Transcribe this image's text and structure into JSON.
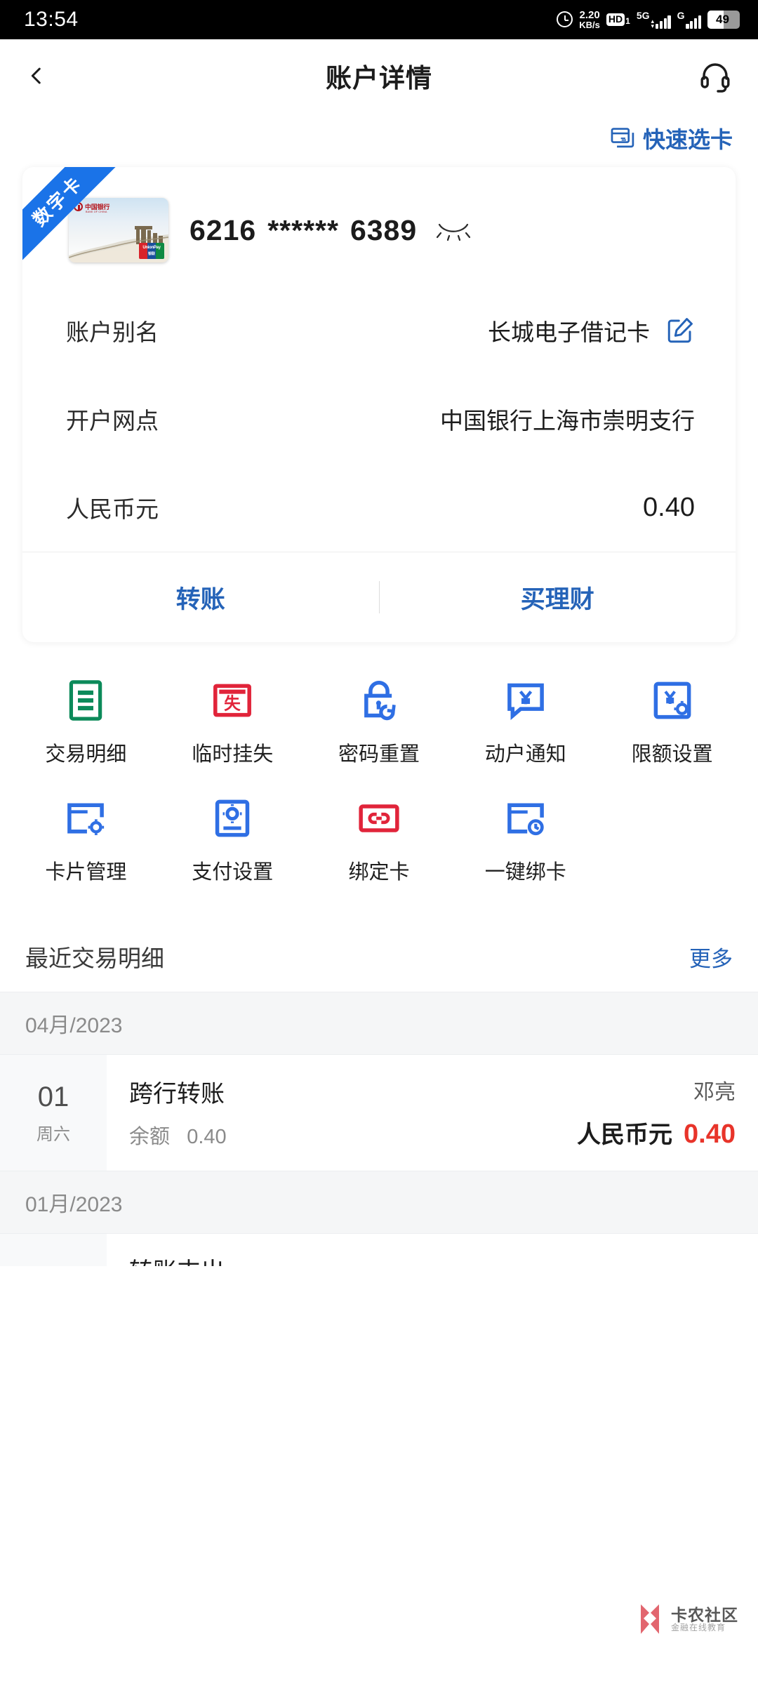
{
  "status_bar": {
    "time": "13:54",
    "network_speed": "2.20",
    "network_speed_unit": "KB/s",
    "hd_label": "HD",
    "hd_sim": "1",
    "sim1_network": "5G",
    "sim2_network": "G",
    "battery": "49"
  },
  "header": {
    "title": "账户详情",
    "back_icon": "chevron-left-icon",
    "service_icon": "headset-icon"
  },
  "quick_select": {
    "label": "快速选卡",
    "icon": "card-stack-icon",
    "color": "#2563b8"
  },
  "card": {
    "ribbon": "数字卡",
    "bank_name": "中国银行",
    "bank_name_en": "BANK OF CHINA",
    "number_prefix": "6216",
    "number_mask": "******",
    "number_suffix": "6389",
    "eye_icon": "eye-closed-icon",
    "rows": [
      {
        "label": "账户别名",
        "value": "长城电子借记卡",
        "icon": "edit-icon"
      },
      {
        "label": "开户网点",
        "value": "中国银行上海市崇明支行",
        "icon": ""
      },
      {
        "label": "人民币元",
        "value": "0.40",
        "icon": ""
      }
    ],
    "actions": [
      {
        "label": "转账"
      },
      {
        "label": "买理财"
      }
    ]
  },
  "functions": [
    {
      "label": "交易明细",
      "icon": "document-list-icon",
      "color": "#0c8a5a"
    },
    {
      "label": "临时挂失",
      "icon": "card-lost-icon",
      "color": "#e1243a"
    },
    {
      "label": "密码重置",
      "icon": "lock-reset-icon",
      "color": "#2f6fe4"
    },
    {
      "label": "动户通知",
      "icon": "yuan-notice-icon",
      "color": "#2f6fe4"
    },
    {
      "label": "限额设置",
      "icon": "yuan-gear-icon",
      "color": "#2f6fe4"
    },
    {
      "label": "卡片管理",
      "icon": "card-gear-icon",
      "color": "#2f6fe4"
    },
    {
      "label": "支付设置",
      "icon": "pay-settings-icon",
      "color": "#2f6fe4"
    },
    {
      "label": "绑定卡",
      "icon": "bind-card-icon",
      "color": "#e1243a"
    },
    {
      "label": "一键绑卡",
      "icon": "card-clock-icon",
      "color": "#2f6fe4"
    }
  ],
  "recent": {
    "title": "最近交易明细",
    "more_label": "更多",
    "groups": [
      {
        "month": "04月/2023",
        "items": [
          {
            "day": "01",
            "weekday": "周六",
            "title": "跨行转账",
            "balance_label": "余额",
            "balance_value": "0.40",
            "counterparty": "邓亮",
            "currency": "人民币元",
            "amount": "0.40",
            "amount_color": "#e8342a"
          }
        ]
      },
      {
        "month": "01月/2023",
        "items": [
          {
            "day": "",
            "weekday": "",
            "title": "转账支出",
            "balance_label": "",
            "balance_value": "",
            "counterparty": "",
            "currency": "",
            "amount": "",
            "amount_color": "#e8342a"
          }
        ]
      }
    ]
  },
  "watermark": {
    "line1": "卡农社区",
    "line2": "金融在线教育"
  }
}
